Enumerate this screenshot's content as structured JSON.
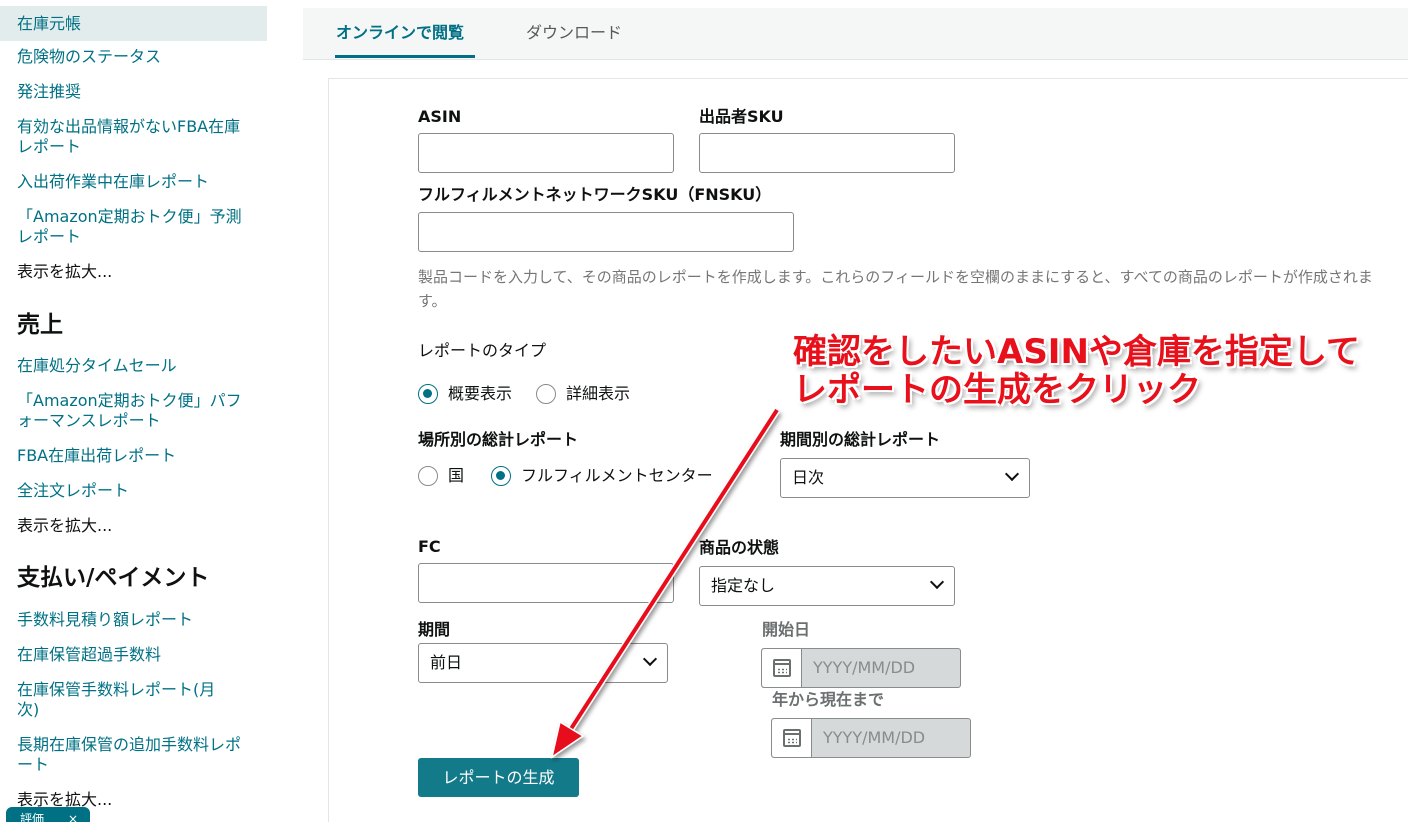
{
  "sidebar": {
    "items_top": [
      {
        "label": "在庫元帳"
      },
      {
        "label": "危険物のステータス"
      },
      {
        "label": "発注推奨"
      },
      {
        "label": "有効な出品情報がないFBA在庫"
      },
      {
        "label": "レポート"
      },
      {
        "label": "入出荷作業中在庫レポート"
      },
      {
        "label": "「Amazon定期おトク便」予測"
      },
      {
        "label": "レポート"
      }
    ],
    "more_1": "表示を拡大...",
    "heading_sales": "売上",
    "items_sales": [
      {
        "label": "在庫処分タイムセール"
      },
      {
        "label": "「Amazon定期おトク便」パフ"
      },
      {
        "label": "ォーマンスレポート"
      },
      {
        "label": "FBA在庫出荷レポート"
      },
      {
        "label": "全注文レポート"
      }
    ],
    "more_2": "表示を拡大...",
    "heading_payments": "支払い/ペイメント",
    "items_payments": [
      {
        "label": "手数料見積り額レポート"
      },
      {
        "label": "在庫保管超過手数料"
      },
      {
        "label": "在庫保管手数料レポート(月"
      },
      {
        "label": "次)"
      },
      {
        "label": "長期在庫保管の追加手数料レポ"
      },
      {
        "label": "ート"
      }
    ],
    "more_3": "表示を拡大...",
    "feedback_label": "評価",
    "feedback_close": "×"
  },
  "tabs": [
    {
      "label": "オンラインで閲覧"
    },
    {
      "label": "ダウンロード"
    }
  ],
  "form": {
    "asin_label": "ASIN",
    "seller_sku_label": "出品者SKU",
    "fnsku_label": "フルフィルメントネットワークSKU（FNSKU）",
    "help_text": "製品コードを入力して、その商品のレポートを作成します。これらのフィールドを空欄のままにすると、すべての商品のレポートが作成されます。",
    "report_type_label": "レポートのタイプ",
    "report_type_options": [
      "概要表示",
      "詳細表示"
    ],
    "location_label": "場所別の総計レポート",
    "location_options": [
      "国",
      "フルフィルメントセンター"
    ],
    "period_agg_label": "期間別の総計レポート",
    "period_agg_value": "日次",
    "fc_label": "FC",
    "condition_label": "商品の状態",
    "condition_value": "指定なし",
    "period_label": "期間",
    "period_value": "前日",
    "start_date_label": "開始日",
    "start_date_placeholder": "YYYY/MM/DD",
    "end_date_label": "年から現在まで",
    "end_date_placeholder": "YYYY/MM/DD",
    "generate_button": "レポートの生成"
  },
  "annotation": {
    "line1": "確認をしたいASINや倉庫を指定して",
    "line2": "レポートの生成をクリック",
    "color": "#e8101a"
  },
  "colors": {
    "accent": "#007185",
    "button": "#137a8a",
    "active_bg": "#e3ecec"
  }
}
